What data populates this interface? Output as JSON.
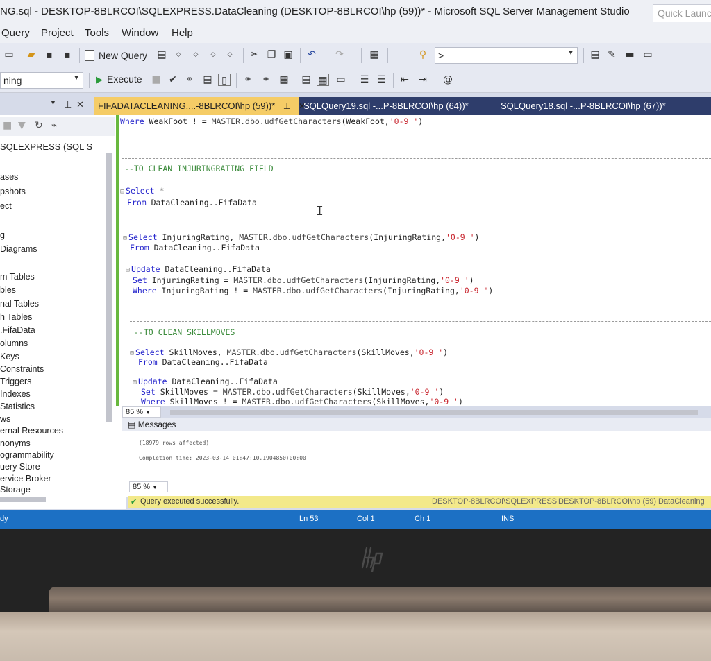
{
  "window": {
    "title": "NG.sql - DESKTOP-8BLRCOI\\SQLEXPRESS.DataCleaning (DESKTOP-8BLRCOI\\hp (59))* - Microsoft SQL Server Management Studio",
    "quick_launch_placeholder": "Quick Launch"
  },
  "menu": {
    "items": [
      "Query",
      "Project",
      "Tools",
      "Window",
      "Help"
    ]
  },
  "toolbar": {
    "new_query": "New Query",
    "search_combo": ">",
    "execute": "Execute",
    "database_combo": "ning"
  },
  "object_explorer": {
    "server": "SQLEXPRESS (SQL S",
    "items": [
      "ases",
      "pshots",
      "ect",
      "g",
      " Diagrams",
      "m Tables",
      "bles",
      "nal Tables",
      "h Tables",
      ".FifaData",
      "olumns",
      "Keys",
      "Constraints",
      "Triggers",
      " Indexes",
      " Statistics",
      "ws",
      "ernal Resources",
      "nonyms",
      "ogrammability",
      "uery Store",
      "ervice Broker",
      "Storage"
    ]
  },
  "tabs": [
    {
      "label": "FIFADATACLEANING....-8BLRCOI\\hp (59))*",
      "active": true
    },
    {
      "label": "SQLQuery19.sql -...P-8BLRCOI\\hp (64))*",
      "active": false
    },
    {
      "label": "SQLQuery18.sql -...P-8BLRCOI\\hp (67))*",
      "active": false
    }
  ],
  "code": {
    "l1_where": "Where",
    "l1_col": " WeakFoot ! = ",
    "l1_fn": "MASTER.dbo.udfGetCharacters",
    "l1_args": "(WeakFoot,",
    "l1_str": "'0-9 '",
    "l1_end": ")",
    "c1": "--TO CLEAN INJURINGRATING FIELD",
    "s1_select": "Select",
    "s1_star": " *",
    "s1_from": "From",
    "s1_tbl": " DataCleaning..FifaData",
    "s2_select": "Select",
    "s2_cols": " InjuringRating, ",
    "s2_fn": "MASTER.dbo.udfGetCharacters",
    "s2_args": "(InjuringRating,",
    "s2_str": "'0-9 '",
    "s2_end": ")",
    "s2_from": "From",
    "s2_tbl": " DataCleaning..FifaData",
    "u1_update": "Update",
    "u1_tbl": " DataCleaning..FifaData",
    "u1_set": "Set",
    "u1_col": " InjuringRating = ",
    "u1_fn": "MASTER.dbo.udfGetCharacters",
    "u1_args": "(InjuringRating,",
    "u1_str": "'0-9 '",
    "u1_end": ")",
    "u1_where": "Where",
    "u1_wcol": " InjuringRating ! = ",
    "u1_wfn": "MASTER.dbo.udfGetCharacters",
    "u1_wargs": "(InjuringRating,",
    "u1_wstr": "'0-9 '",
    "u1_wend": ")",
    "c2": "--TO CLEAN SKILLMOVES",
    "s3_select": "Select",
    "s3_cols": " SkillMoves, ",
    "s3_fn": "MASTER.dbo.udfGetCharacters",
    "s3_args": "(SkillMoves,",
    "s3_str": "'0-9 '",
    "s3_end": ")",
    "s3_from": "From",
    "s3_tbl": " DataCleaning..FifaData",
    "u2_update": "Update",
    "u2_tbl": " DataCleaning..FifaData",
    "u2_set": "Set",
    "u2_col": " SkillMoves = ",
    "u2_fn": "MASTER.dbo.udfGetCharacters",
    "u2_args": "(SkillMoves,",
    "u2_str": "'0-9 '",
    "u2_end": ")",
    "u2_where": "Where",
    "u2_wcol": " SkillMoves ! = ",
    "u2_wfn": "MASTER.dbo.udfGetCharacters",
    "u2_wargs": "(SkillMoves,",
    "u2_wstr": "'0-9 '",
    "u2_wend": ")"
  },
  "editor_zoom": "85 %",
  "results": {
    "tab": "Messages",
    "rows_affected": "(18979 rows affected)",
    "completion": "Completion time: 2023-03-14T01:47:10.1904850+00:00",
    "zoom": "85 %"
  },
  "query_status": {
    "message": "Query executed successfully.",
    "server": "DESKTOP-8BLRCOI\\SQLEXPRESS ...",
    "user": "DESKTOP-8BLRCOI\\hp (59)",
    "database": "DataCleaning"
  },
  "status_bar": {
    "state": "dy",
    "ln": "Ln 53",
    "col": "Col 1",
    "ch": "Ch 1",
    "mode": "INS"
  },
  "colors": {
    "active_tab": "#f5cc66",
    "tab_bar": "#2e3d6b",
    "status_bar": "#1c70c4",
    "query_status": "#f3e98a",
    "keyword": "#2424cc",
    "string": "#c8232c",
    "comment": "#3a8a3a"
  }
}
